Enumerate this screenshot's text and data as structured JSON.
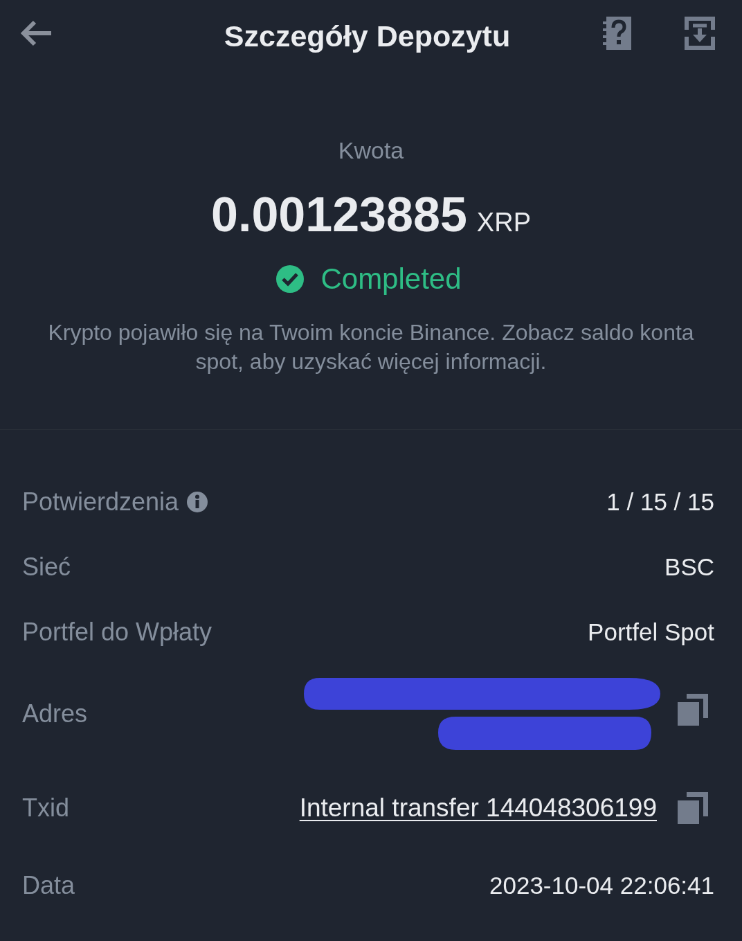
{
  "header": {
    "title": "Szczegóły Depozytu"
  },
  "summary": {
    "label": "Kwota",
    "amount": "0.00123885",
    "currency": "XRP",
    "status": {
      "kind": "completed",
      "label": "Completed"
    },
    "note": "Krypto pojawiło się na Twoim koncie Binance. Zobacz saldo konta spot, aby uzyskać więcej informacji."
  },
  "details": [
    {
      "kind": "text",
      "label": "Potwierdzenia",
      "info": true,
      "copyable": false,
      "value": "1 / 15 / 15"
    },
    {
      "kind": "text",
      "label": "Sieć",
      "info": false,
      "copyable": false,
      "value": "BSC"
    },
    {
      "kind": "text",
      "label": "Portfel do Wpłaty",
      "info": false,
      "copyable": false,
      "value": "Portfel Spot"
    },
    {
      "kind": "redacted",
      "label": "Adres",
      "info": false,
      "copyable": true
    },
    {
      "kind": "link",
      "label": "Txid",
      "info": false,
      "copyable": true,
      "value": "Internal transfer 144048306199"
    },
    {
      "kind": "text",
      "label": "Data",
      "info": false,
      "copyable": false,
      "value": "2023-10-04 22:06:41"
    }
  ]
}
